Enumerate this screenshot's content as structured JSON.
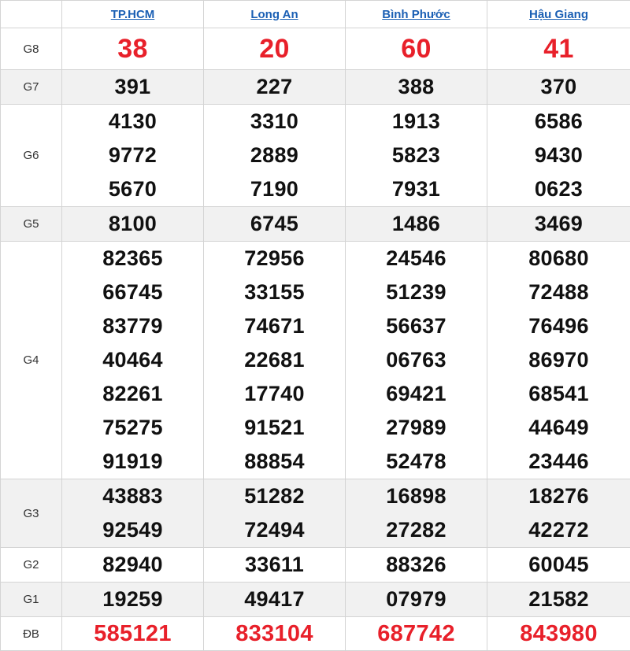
{
  "header": {
    "provinces": [
      "TP.HCM",
      "Long An",
      "Bình Phước",
      "Hậu Giang"
    ]
  },
  "colors": {
    "red": "#e8202a",
    "link": "#1a5fb4",
    "shade": "#f1f1f1"
  },
  "rows": [
    {
      "label": "G8",
      "values": [
        [
          "38"
        ],
        [
          "20"
        ],
        [
          "60"
        ],
        [
          "41"
        ]
      ]
    },
    {
      "label": "G7",
      "values": [
        [
          "391"
        ],
        [
          "227"
        ],
        [
          "388"
        ],
        [
          "370"
        ]
      ]
    },
    {
      "label": "G6",
      "values": [
        [
          "4130",
          "9772",
          "5670"
        ],
        [
          "3310",
          "2889",
          "7190"
        ],
        [
          "1913",
          "5823",
          "7931"
        ],
        [
          "6586",
          "9430",
          "0623"
        ]
      ]
    },
    {
      "label": "G5",
      "values": [
        [
          "8100"
        ],
        [
          "6745"
        ],
        [
          "1486"
        ],
        [
          "3469"
        ]
      ]
    },
    {
      "label": "G4",
      "values": [
        [
          "82365",
          "66745",
          "83779",
          "40464",
          "82261",
          "75275",
          "91919"
        ],
        [
          "72956",
          "33155",
          "74671",
          "22681",
          "17740",
          "91521",
          "88854"
        ],
        [
          "24546",
          "51239",
          "56637",
          "06763",
          "69421",
          "27989",
          "52478"
        ],
        [
          "80680",
          "72488",
          "76496",
          "86970",
          "68541",
          "44649",
          "23446"
        ]
      ]
    },
    {
      "label": "G3",
      "values": [
        [
          "43883",
          "92549"
        ],
        [
          "51282",
          "72494"
        ],
        [
          "16898",
          "27282"
        ],
        [
          "18276",
          "42272"
        ]
      ]
    },
    {
      "label": "G2",
      "values": [
        [
          "82940"
        ],
        [
          "33611"
        ],
        [
          "88326"
        ],
        [
          "60045"
        ]
      ]
    },
    {
      "label": "G1",
      "values": [
        [
          "19259"
        ],
        [
          "49417"
        ],
        [
          "07979"
        ],
        [
          "21582"
        ]
      ]
    },
    {
      "label": "ĐB",
      "values": [
        [
          "585121"
        ],
        [
          "833104"
        ],
        [
          "687742"
        ],
        [
          "843980"
        ]
      ]
    }
  ]
}
